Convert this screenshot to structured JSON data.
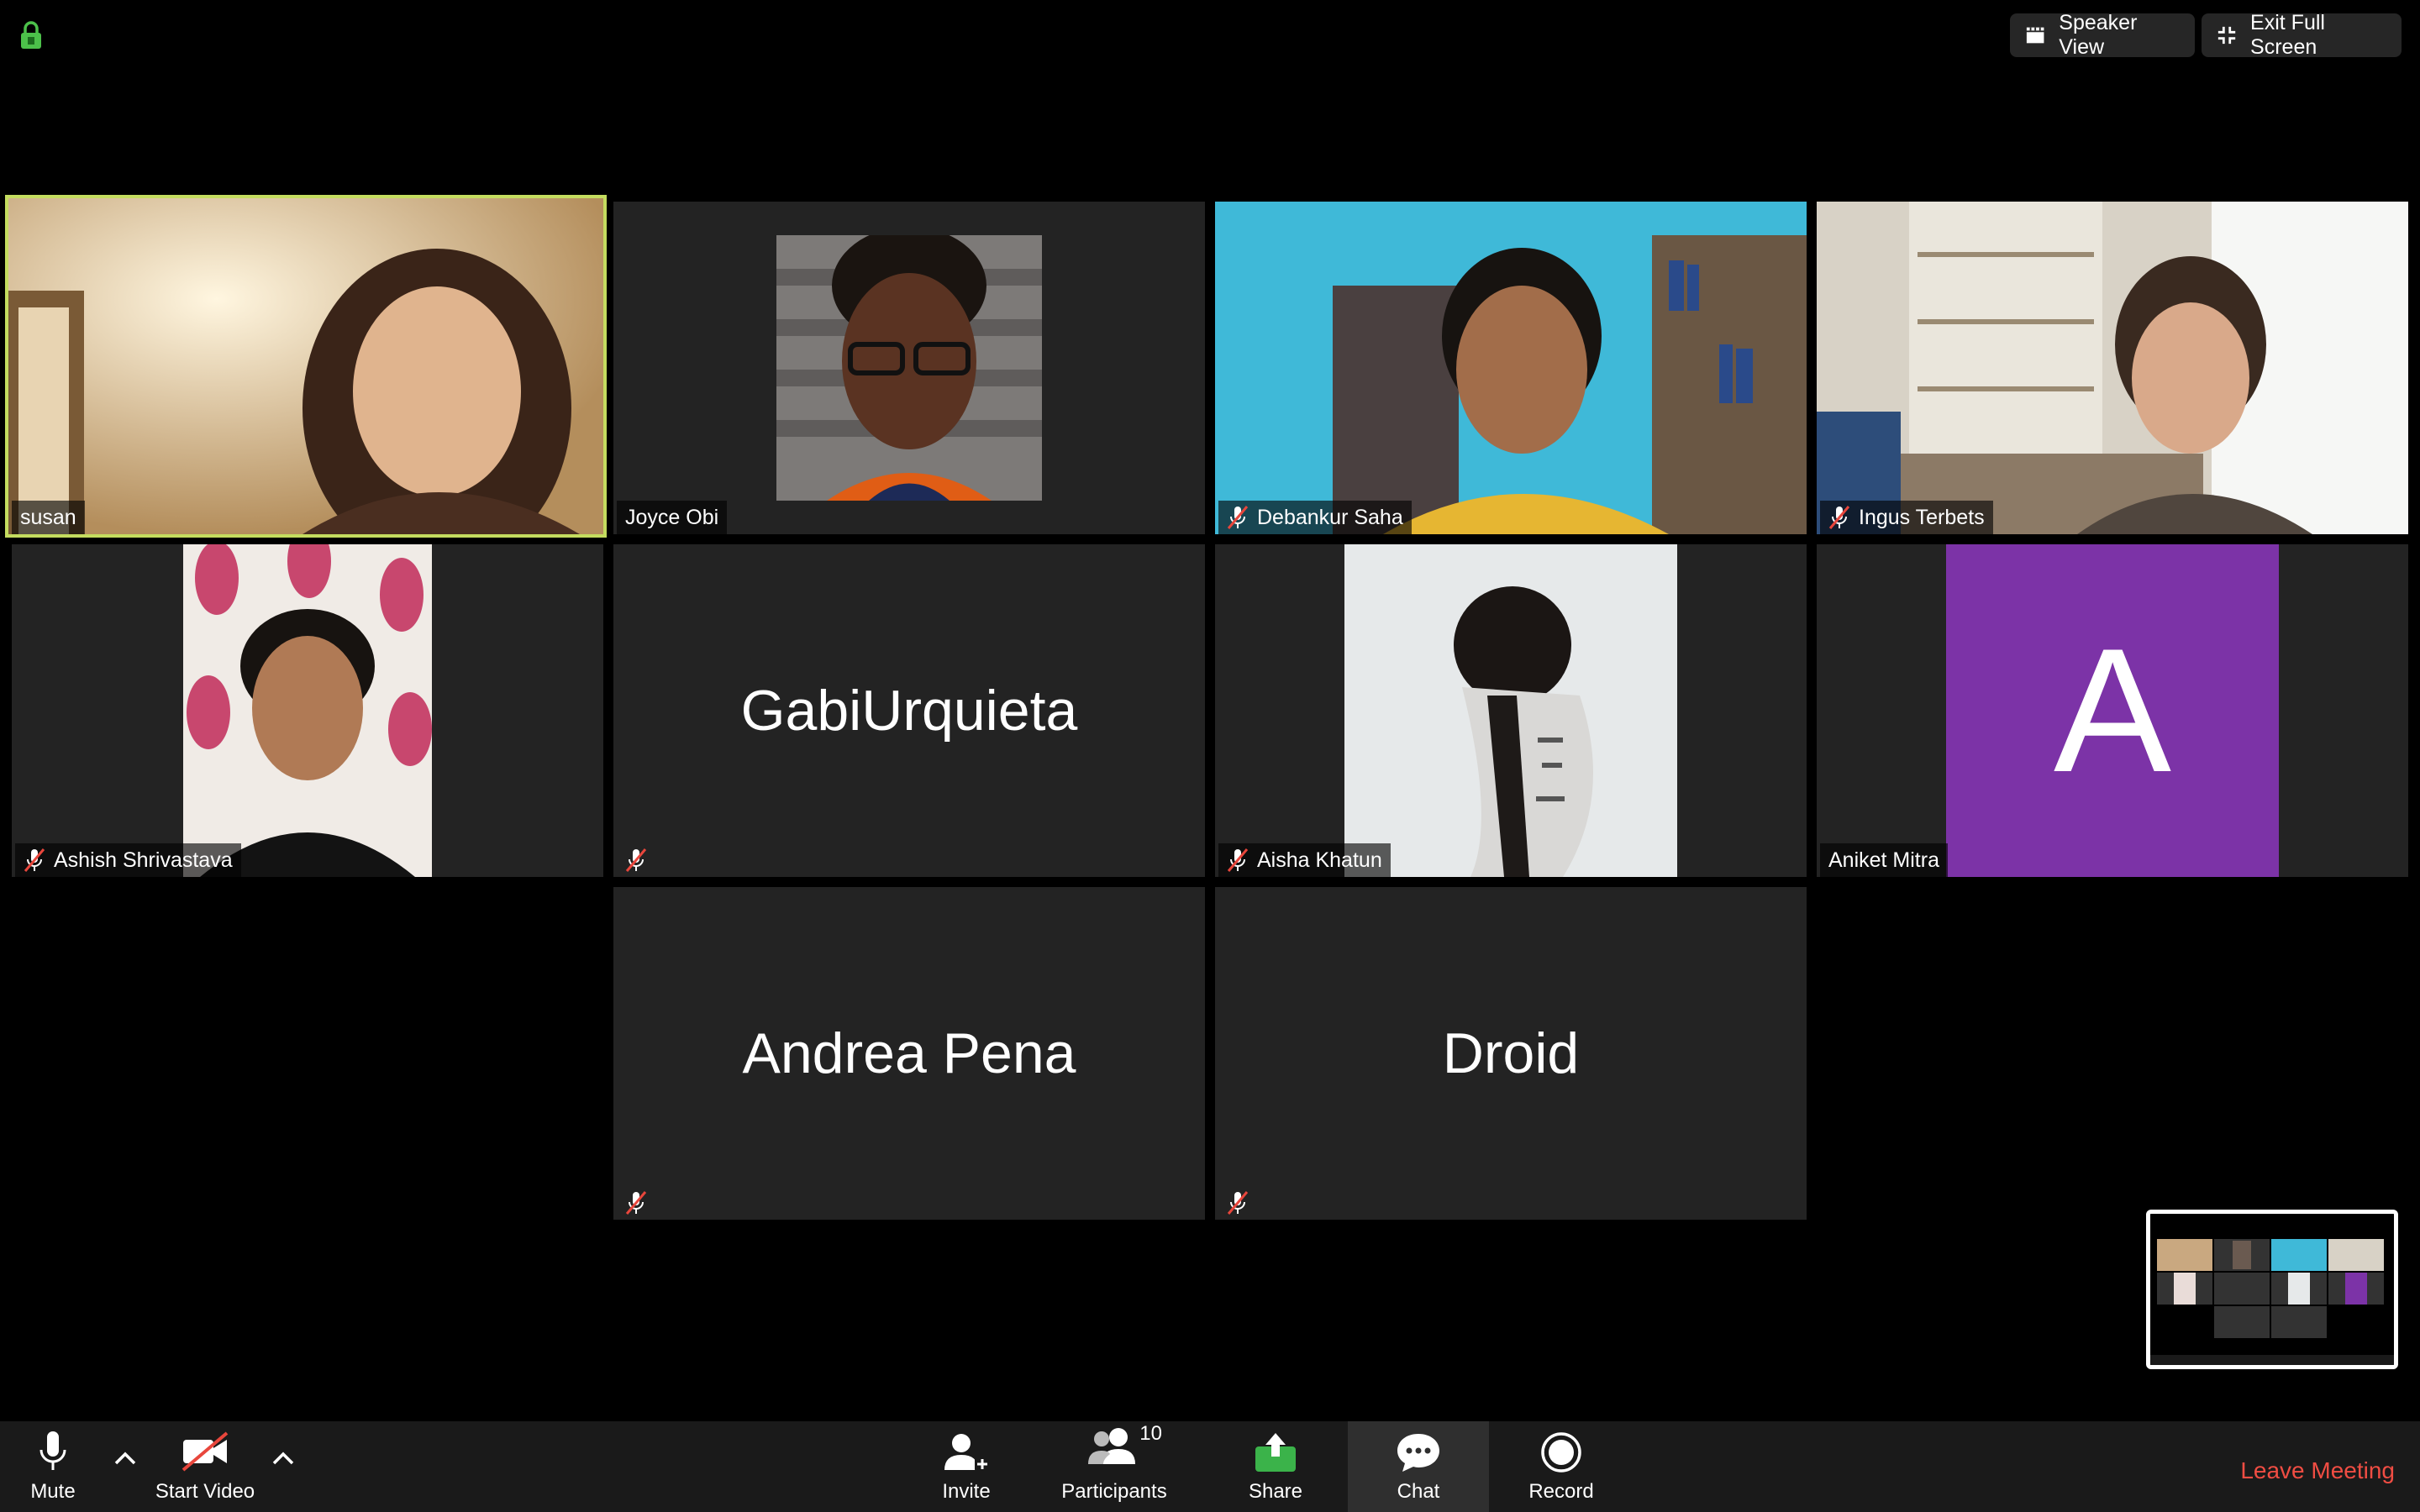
{
  "top_bar": {
    "speaker_view_label": "Speaker View",
    "exit_fullscreen_label": "Exit Full Screen"
  },
  "participants": {
    "susan": "susan",
    "joyce": "Joyce Obi",
    "debankur": "Debankur Saha",
    "ingus": "Ingus Terbets",
    "ashish": "Ashish Shrivastava",
    "gabi": "GabiUrquieta",
    "aisha": "Aisha Khatun",
    "aniket": "Aniket Mitra",
    "aniket_initial": "A",
    "andrea": "Andrea Pena",
    "droid": "Droid"
  },
  "toolbar": {
    "mute_label": "Mute",
    "start_video_label": "Start Video",
    "invite_label": "Invite",
    "participants_label": "Participants",
    "participants_count": "10",
    "share_label": "Share",
    "chat_label": "Chat",
    "record_label": "Record",
    "leave_label": "Leave Meeting"
  },
  "colors": {
    "active_speaker_border": "#c4dc5f",
    "share_green": "#3bb34a",
    "leave_red": "#f04d43",
    "avatar_purple": "#7c33a7"
  }
}
